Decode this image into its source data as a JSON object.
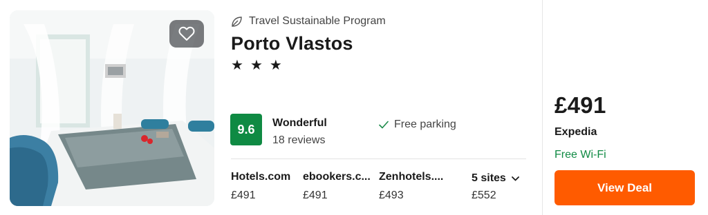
{
  "hotel": {
    "program": "Travel Sustainable Program",
    "name": "Porto Vlastos",
    "stars": [
      "★",
      "★",
      "★"
    ]
  },
  "rating": {
    "score": "9.6",
    "label": "Wonderful",
    "reviews": "18 reviews"
  },
  "amenities": [
    "Free parking"
  ],
  "sites": [
    {
      "name": "Hotels.com",
      "price": "£491"
    },
    {
      "name": "ebookers.c...",
      "price": "£491"
    },
    {
      "name": "Zenhotels....",
      "price": "£493"
    }
  ],
  "more_sites": {
    "label": "5 sites",
    "price": "£552"
  },
  "deal": {
    "price": "£491",
    "provider": "Expedia",
    "perk": "Free Wi-Fi",
    "button_label": "View Deal"
  },
  "colors": {
    "score_bg": "#0f8a43",
    "perk_text": "#0f8a43",
    "cta": "#ff5b00"
  },
  "icons": [
    "heart-icon",
    "leaf-icon",
    "check-icon",
    "chevron-down-icon"
  ]
}
